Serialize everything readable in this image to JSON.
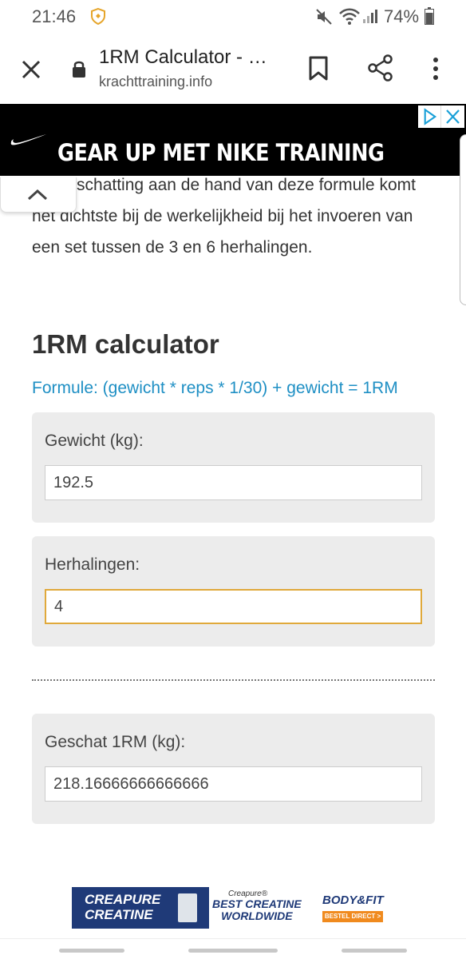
{
  "status": {
    "time": "21:46",
    "battery": "74%"
  },
  "browser": {
    "title": "1RM Calculator - …",
    "url": "krachttraining.info"
  },
  "ad_top": {
    "headline": "GEAR UP MET NIKE TRAINING",
    "brand_icon": "nike-swoosh"
  },
  "article": {
    "paragraph": "... De schatting aan de hand van deze formule komt het dichtste bij de werkelijkheid bij het invoeren van een set tussen de 3 en 6 herhalingen.",
    "heading": "1RM calculator",
    "formula": "Formule: (gewicht * reps * 1/30) + gewicht = 1RM"
  },
  "calculator": {
    "weight_label": "Gewicht (kg):",
    "weight_value": "192.5",
    "reps_label": "Herhalingen:",
    "reps_value": "4",
    "result_label": "Geschat 1RM (kg):",
    "result_value": "218.16666666666666"
  },
  "ad_bottom": {
    "creapure_title_1": "CREAPURE",
    "creapure_title_2": "CREATINE",
    "creapure_small": "Creapure®",
    "best_line_1": "BEST CREATINE",
    "best_line_2": "WORLDWIDE",
    "bodyfit": "BODY&FIT",
    "bodyfit_cta": "BESTEL DIRECT >"
  },
  "colors": {
    "accent_link": "#1e8fc4",
    "focus_border": "#e0a93b",
    "panel_bg": "#ececec"
  }
}
